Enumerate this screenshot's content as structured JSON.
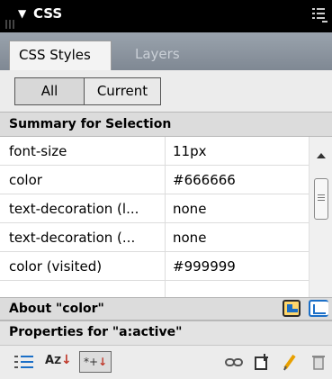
{
  "panel": {
    "title": "CSS"
  },
  "tabs": [
    {
      "label": "CSS Styles",
      "active": true
    },
    {
      "label": "Layers",
      "active": false
    }
  ],
  "mode_toggle": {
    "all_label": "All",
    "current_label": "Current",
    "selected": "All"
  },
  "summary": {
    "header": "Summary for Selection",
    "rows": [
      {
        "name": "font-size",
        "value": "11px"
      },
      {
        "name": "color",
        "value": "#666666"
      },
      {
        "name": "text-decoration (l...",
        "value": "none"
      },
      {
        "name": "text-decoration (...",
        "value": "none"
      },
      {
        "name": "color (visited)",
        "value": "#999999"
      }
    ]
  },
  "about": {
    "header": "About \"color\""
  },
  "properties": {
    "header": "Properties for \"a:active\""
  },
  "toolbar": {
    "az_label": "A",
    "az_sub": "Z",
    "set_label": "*+"
  },
  "colors": {
    "title_bg": "#000000",
    "tab_strip": "#8a939d",
    "accent_blue": "#1b6fc7",
    "header_bg": "#dcdcdc"
  },
  "icons": [
    "panel-options-icon",
    "show-info-icon",
    "show-cascade-icon",
    "category-view-icon",
    "az-view-icon",
    "set-properties-icon",
    "attach-stylesheet-icon",
    "new-rule-icon",
    "edit-style-icon",
    "delete-rule-icon"
  ]
}
